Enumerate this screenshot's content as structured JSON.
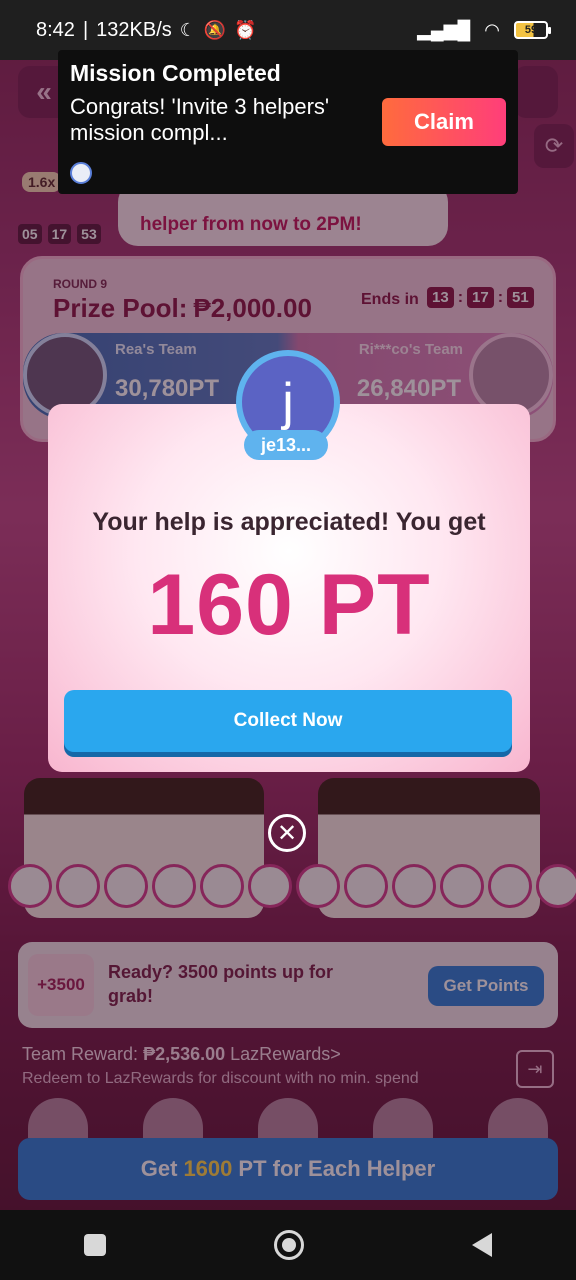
{
  "status_bar": {
    "time": "8:42",
    "network_speed": "132KB/s",
    "battery_level": "59",
    "icons": [
      "moon-icon",
      "bell-off-icon",
      "alarm-icon",
      "signal-icon",
      "wifi-icon",
      "battery-icon"
    ]
  },
  "notification": {
    "title": "Mission Completed",
    "body": "Congrats! 'Invite 3 helpers' mission compl...",
    "claim_label": "Claim",
    "claim_gradient": [
      "#ff6b3d",
      "#ff3e7a"
    ]
  },
  "background": {
    "multiplier": "1.6x",
    "timer": [
      "05",
      "17",
      "53"
    ],
    "info_text": "helper from now to 2PM!",
    "prize": {
      "round": "ROUND 9",
      "title": "Prize Pool:",
      "amount": "₱2,000.00",
      "ends_label": "Ends in",
      "ends_timer": [
        "13",
        "17",
        "51"
      ]
    },
    "teams": {
      "left_name": "Rea's Team",
      "left_score": "30,780PT",
      "right_name": "Ri***co's Team",
      "right_score": "26,840PT"
    },
    "points_card": {
      "badge": "+3500",
      "text": "Ready? 3500 points up for grab!",
      "button": "Get Points"
    },
    "team_reward": {
      "label": "Team Reward:",
      "amount": "₱2,536.00",
      "link": "LazRewards>",
      "note": "Redeem to LazRewards for discount with no min. spend"
    },
    "cta": {
      "prefix": "Get",
      "highlight": "1600",
      "suffix": "PT for Each Helper"
    }
  },
  "modal": {
    "avatar_letter": "j",
    "user_name": "je13...",
    "message": "Your help is appreciated! You get",
    "points": "160 PT",
    "collect_label": "Collect Now",
    "accent_color": "#d8307a",
    "button_color": "#2aa7ee"
  }
}
